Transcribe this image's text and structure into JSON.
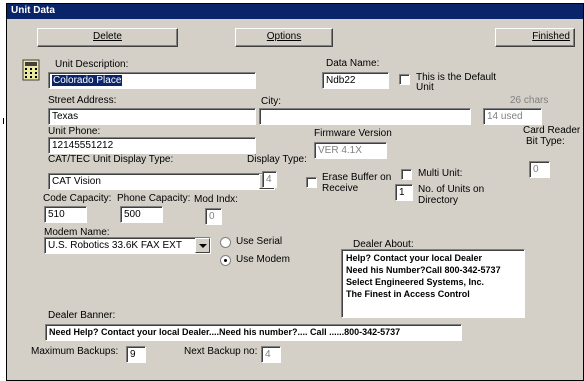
{
  "window": {
    "title": "Unit Data"
  },
  "toolbar": {
    "delete_label": "Delete",
    "options_label": "Options",
    "finished_label": "Finished"
  },
  "fields": {
    "unit_description": {
      "label": "Unit Description:",
      "value": "Colorado Place"
    },
    "data_name": {
      "label": "Data Name:",
      "value": "Ndb22"
    },
    "default_unit": {
      "label_line1": "This is the Default",
      "label_line2": "Unit",
      "checked": false
    },
    "street_address": {
      "label": "Street Address:",
      "value": "Texas"
    },
    "city": {
      "label": "City:",
      "value": ""
    },
    "chars": {
      "label": "26 chars",
      "value": "14 used"
    },
    "unit_phone": {
      "label": "Unit Phone:",
      "value": "12145551212"
    },
    "firmware": {
      "label": "Firmware Version",
      "value": "VER 4.1X"
    },
    "card_reader": {
      "label_line1": "Card Reader",
      "label_line2": "Bit Type:",
      "value": "0"
    },
    "display_type_combo": {
      "label": "CAT/TEC Unit Display Type:",
      "value": "CAT Vision"
    },
    "display_type": {
      "label": "Display Type:",
      "value": "4"
    },
    "erase_buffer": {
      "label_line1": "Erase Buffer on",
      "label_line2": "Receive",
      "checked": false
    },
    "multi_unit": {
      "label": "Multi Unit:",
      "checked": false
    },
    "units_on_directory": {
      "label_line1": "No. of Units on",
      "label_line2": "Directory",
      "value": "1"
    },
    "code_capacity": {
      "label": "Code  Capacity:",
      "value": "510"
    },
    "phone_capacity": {
      "label": "Phone Capacity:",
      "value": "500"
    },
    "mod_indx": {
      "label": "Mod Indx:",
      "value": "0"
    },
    "modem_name": {
      "label": "Modem Name:",
      "value": "U.S. Robotics 33.6K FAX EXT"
    },
    "use_serial": {
      "label": "Use Serial",
      "selected": false
    },
    "use_modem": {
      "label": "Use Modem",
      "selected": true
    },
    "dealer_about": {
      "label": "Dealer About:",
      "lines": [
        "Help? Contact  your local Dealer",
        "Need his Number?Call 800-342-5737",
        "Select Engineered Systems, Inc.",
        "The Finest in Access Control"
      ]
    },
    "dealer_banner": {
      "label": "Dealer Banner:",
      "value": "Need Help?  Contact your local Dealer....Need his number?.... Call ......800-342-5737"
    },
    "maximum_backups": {
      "label": "Maximum Backups:",
      "value": "9"
    },
    "next_backup": {
      "label": "Next Backup no:",
      "value": "4"
    }
  },
  "icons": {
    "unit_icon": "phone-keypad-icon"
  },
  "colors": {
    "titlebar": "#0a246a",
    "window_bg": "#d4d0c8",
    "selection": "#0a246a"
  }
}
